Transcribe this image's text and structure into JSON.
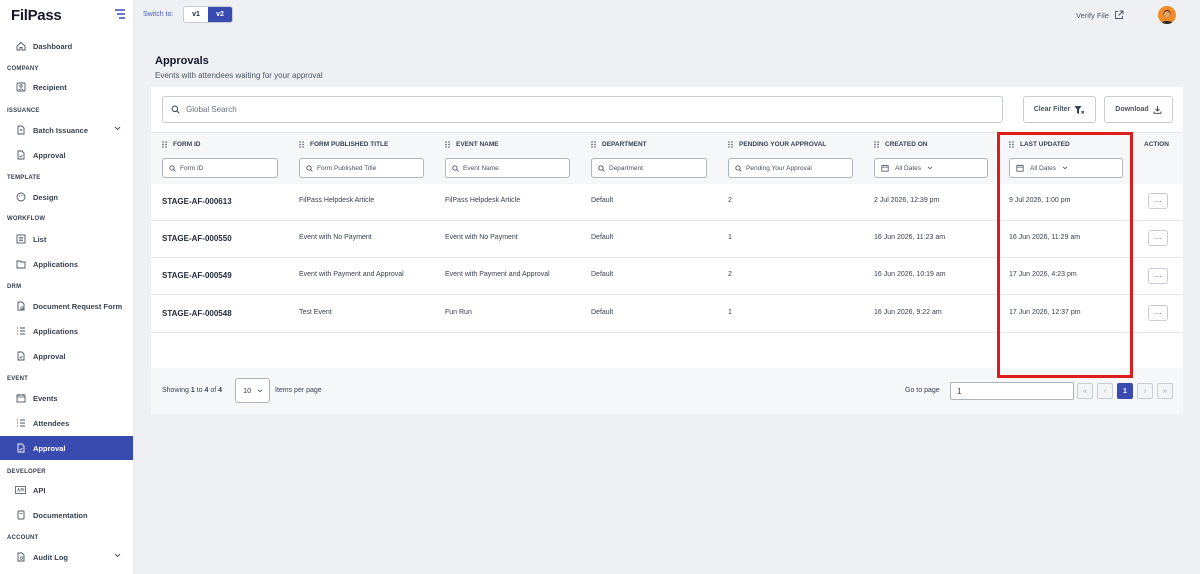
{
  "app": {
    "logo": "FilPass"
  },
  "topbar": {
    "switch_label": "Switch to:",
    "versions": [
      "v1",
      "v2"
    ],
    "active_version": "v2",
    "verify_label": "Verify File"
  },
  "sidebar": {
    "dashboard": "Dashboard",
    "company_head": "COMPANY",
    "recipient": "Recipient",
    "issuance_head": "ISSUANCE",
    "batch_issuance": "Batch Issuance",
    "issuance_approval": "Approval",
    "template_head": "TEMPLATE",
    "design": "Design",
    "workflow_head": "WORKFLOW",
    "list": "List",
    "workflow_applications": "Applications",
    "drm_head": "DRM",
    "document_request_form": "Document Request Form",
    "drm_applications": "Applications",
    "drm_approval": "Approval",
    "event_head": "EVENT",
    "events": "Events",
    "attendees": "Attendees",
    "event_approval": "Approval",
    "developer_head": "DEVELOPER",
    "api": "API",
    "documentation": "Documentation",
    "account_head": "ACCOUNT",
    "audit_log": "Audit Log"
  },
  "page": {
    "title": "Approvals",
    "subtitle": "Events with attendees waiting for your approval"
  },
  "toolbar": {
    "search_placeholder": "Global Search",
    "clear_filter": "Clear Filter",
    "download": "Download"
  },
  "table": {
    "headers": {
      "form_id": "FORM ID",
      "form_title": "FORM PUBLISHED TITLE",
      "event_name": "EVENT NAME",
      "department": "DEPARTMENT",
      "pending": "PENDING YOUR APPROVAL",
      "created": "CREATED ON",
      "updated": "LAST UPDATED",
      "action": "ACTION"
    },
    "filters": {
      "form_id": "Form ID",
      "form_title": "Form Published Title",
      "event_name": "Event Name",
      "department": "Department",
      "pending": "Pending Your Approval",
      "created": "All Dates",
      "updated": "All Dates"
    },
    "rows": [
      {
        "form_id": "STAGE-AF-000613",
        "form_title": "FilPass Helpdesk Article",
        "event_name": "FilPass Helpdesk Article",
        "department": "Default",
        "pending": "2",
        "created": "2 Jul 2026, 12:39 pm",
        "updated": "9 Jul 2026, 1:00 pm",
        "action": "···"
      },
      {
        "form_id": "STAGE-AF-000550",
        "form_title": "Event with No Payment",
        "event_name": "Event with No Payment",
        "department": "Default",
        "pending": "1",
        "created": "16 Jun 2026, 11:23 am",
        "updated": "16 Jun 2026, 11:29 am",
        "action": "···"
      },
      {
        "form_id": "STAGE-AF-000549",
        "form_title": "Event with Payment and Approval",
        "event_name": "Event with Payment and Approval",
        "department": "Default",
        "pending": "2",
        "created": "16 Jun 2026, 10:19 am",
        "updated": "17 Jun 2026, 4:23 pm",
        "action": "···"
      },
      {
        "form_id": "STAGE-AF-000548",
        "form_title": "Test Event",
        "event_name": "Fun Run",
        "department": "Default",
        "pending": "1",
        "created": "16 Jun 2026, 9:22 am",
        "updated": "17 Jun 2026, 12:37 pm",
        "action": "···"
      }
    ]
  },
  "pagination": {
    "showing_prefix": "Showing",
    "from": "1",
    "to_word": "to",
    "to": "4",
    "of_word": "of",
    "total": "4",
    "per_page": "10",
    "per_page_label": "Items per page",
    "goto_label": "Go to page",
    "goto_value": "1",
    "first": "«",
    "prev": "‹",
    "current": "1",
    "next": "›",
    "last": "»"
  },
  "colors": {
    "accent": "#3a4bb0",
    "highlight": "#dd1c1c"
  }
}
